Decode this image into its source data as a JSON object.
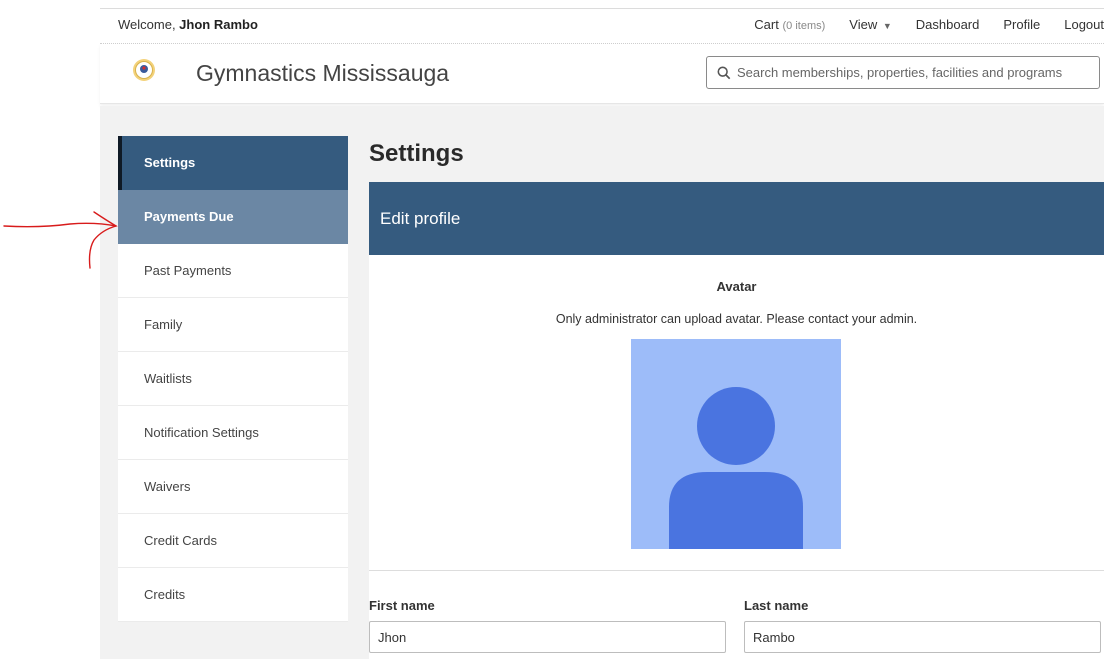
{
  "topbar": {
    "welcome_prefix": "Welcome, ",
    "user_name": "Jhon Rambo",
    "cart_label": "Cart",
    "cart_count": "(0 items)",
    "view_label": "View",
    "dashboard_label": "Dashboard",
    "profile_label": "Profile",
    "logout_label": "Logout"
  },
  "header": {
    "brand": "Gymnastics Mississauga",
    "search_placeholder": "Search memberships, properties, facilities and programs"
  },
  "sidebar": {
    "items": [
      {
        "label": "Settings",
        "state": "active"
      },
      {
        "label": "Payments Due",
        "state": "hover"
      },
      {
        "label": "Past Payments"
      },
      {
        "label": "Family"
      },
      {
        "label": "Waitlists"
      },
      {
        "label": "Notification Settings"
      },
      {
        "label": "Waivers"
      },
      {
        "label": "Credit Cards"
      },
      {
        "label": "Credits"
      }
    ]
  },
  "main": {
    "title": "Settings",
    "panel_title": "Edit profile",
    "avatar_label": "Avatar",
    "avatar_note": "Only administrator can upload avatar. Please contact your admin.",
    "first_name_label": "First name",
    "first_name_value": "Jhon",
    "last_name_label": "Last name",
    "last_name_value": "Rambo"
  },
  "colors": {
    "accent": "#355b7f",
    "sidebar_hover": "#6b87a4",
    "avatar_bg": "#9dbcf9",
    "avatar_fg": "#4a74e0",
    "annotation": "#d81b1b"
  },
  "icons": {
    "search": "search-icon",
    "logo": "club-logo-icon",
    "avatar": "user-avatar-icon",
    "view_caret": "caret-down-icon"
  }
}
